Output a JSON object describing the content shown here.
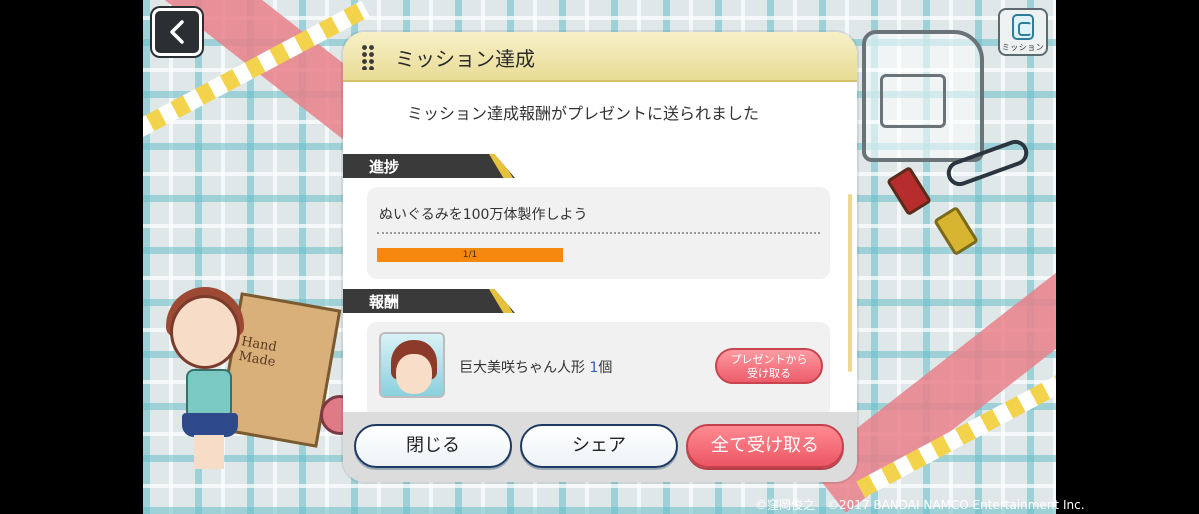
{
  "dialog": {
    "title": "ミッション達成",
    "notice": "ミッション達成報酬がプレゼントに送られました",
    "progress_section": "進捗",
    "task": "ぬいぐるみを100万体製作しよう",
    "progress_text": "1/1",
    "progress_fraction": 1.0,
    "reward_section": "報酬",
    "reward_name": "巨大美咲ちゃん人形",
    "reward_qty": "1",
    "reward_unit": "個",
    "receive_present_label": "プレゼントから\n受け取る",
    "close_label": "閉じる",
    "share_label": "シェア",
    "receive_all_label": "全て受け取る"
  },
  "mission_button": {
    "label": "ミッション"
  },
  "box_text": "Hand\nMade",
  "copyright": "©窪岡俊之　©2017 BANDAI NAMCO Entertainment Inc.",
  "colors": {
    "header": "#e9dc97",
    "progress_fill": "#f6870f",
    "primary_red": "#ec5763",
    "button_border": "#1d3a63"
  }
}
